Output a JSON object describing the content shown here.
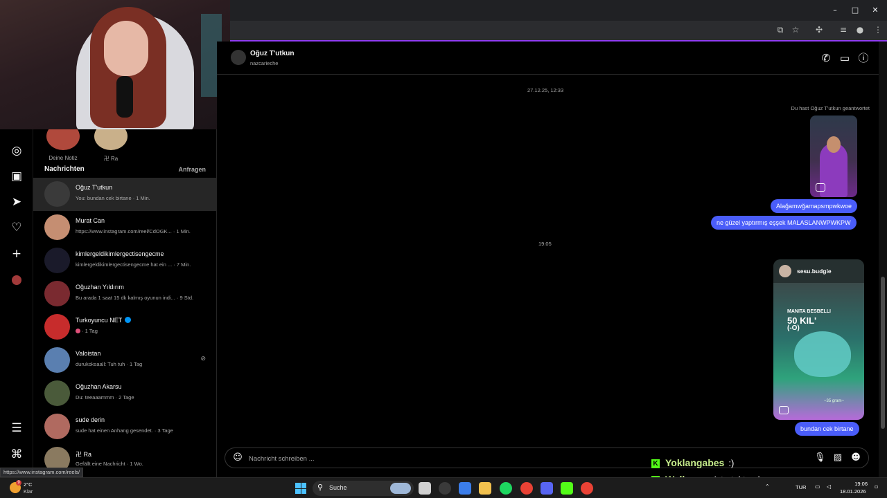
{
  "browser": {
    "window_controls": {
      "minimize": "–",
      "maximize": "□",
      "close": "✕"
    },
    "toolbar_icons": [
      "install-icon",
      "star-icon",
      "extensions-icon",
      "media-icon",
      "profile-icon",
      "menu-icon"
    ]
  },
  "rail": {
    "items": [
      "explore-icon",
      "reels-icon",
      "messages-icon",
      "notifications-icon",
      "create-icon",
      "profile-avatar",
      "menu-icon",
      "threads-icon"
    ]
  },
  "notes": [
    {
      "label": "Deine Notiz",
      "color": "#b0493c"
    },
    {
      "label": "卍 Ra",
      "color": "#c9b08a"
    }
  ],
  "list": {
    "title": "Nachrichten",
    "requests_label": "Anfragen",
    "conversations": [
      {
        "name": "Oğuz T'utkun",
        "preview": "You: bundan cek birtane · 1 Min.",
        "color": "#3a3a3a",
        "active": true
      },
      {
        "name": "Murat Can",
        "preview": "https://www.instagram.com/reel/CdOGK... · 1 Min.",
        "color": "#c58e72"
      },
      {
        "name": "kimlergeldikimlergectisengecme",
        "preview": "kimlergeldikimlergectisengecme hat ein ... · 7 Min.",
        "color": "#1a1a2a"
      },
      {
        "name": "Oğuzhan Yıldırım",
        "preview": "Bu arada 1 saat 15 dk kalmış oyunun indi... · 9 Std.",
        "color": "#7a2a30"
      },
      {
        "name": "Turkoyuncu NET",
        "preview": "· 1 Tag",
        "color": "#c72c2c",
        "verified": true
      },
      {
        "name": "Valoistan",
        "preview": "durukoksaall: Tuh tuh · 1 Tag",
        "color": "#5a7fb0",
        "muted": true
      },
      {
        "name": "Oğuzhan Akarsu",
        "preview": "Du: teeaaammm · 2 Tage",
        "color": "#4a5a3a"
      },
      {
        "name": "sude derin",
        "preview": "sude hat einen Anhang gesendet. · 3 Tage",
        "color": "#b06a60"
      },
      {
        "name": "卍 Ra",
        "preview": "Gefällt eine Nachricht · 1 Wo.",
        "color": "#8a7a60"
      }
    ]
  },
  "chat": {
    "contact_name": "Oğuz T'utkun",
    "contact_username": "nazcarieche",
    "timestamp_1": "27.12.25, 12:33",
    "reply_note": "Du hast Oğuz T'utkun geantwortet",
    "messages": [
      "Alağamwğamapsmpwkwoe",
      "ne güzel yaptırmış eşşek MALASLANWPWKPW"
    ],
    "timestamp_2": "19:05",
    "shared_post": {
      "username": "sesu.budgie",
      "caption_line1": "MANITA BESBELLI",
      "caption_line2": "50 KIL'",
      "caption_line3": "(-O)",
      "caption_small": "~35 gram~"
    },
    "last_message": "bundan cek birtane",
    "composer_placeholder": "Nachricht schreiben ..."
  },
  "stream_overlay": [
    {
      "user": "Yoklangabes",
      "text": ":)"
    },
    {
      "user": "Wallgoo",
      "text": "o işte tekte olmuyo"
    }
  ],
  "status_url": "https://www.instagram.com/reels/",
  "taskbar": {
    "weather_badge": "9",
    "weather_temp": "2°C",
    "weather_desc": "Klar",
    "search_label": "Suche",
    "language": "TUR",
    "time": "19:06",
    "date": "18.01.2026"
  }
}
